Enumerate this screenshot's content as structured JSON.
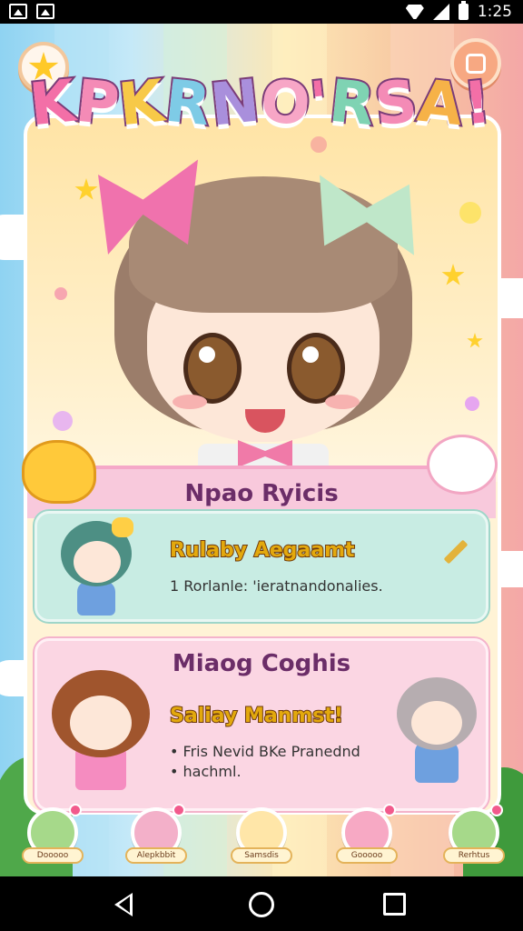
{
  "status_bar": {
    "time": "1:25"
  },
  "header": {
    "logo_letters": [
      {
        "ch": "K",
        "color": "#f36fa7"
      },
      {
        "ch": "P",
        "color": "#f48bb6"
      },
      {
        "ch": "K",
        "color": "#f7c948"
      },
      {
        "ch": "R",
        "color": "#7ecbe6"
      },
      {
        "ch": "N",
        "color": "#a98fdc"
      },
      {
        "ch": "O",
        "color": "#f7a6c6"
      },
      {
        "ch": "'",
        "color": "#f36fa7"
      },
      {
        "ch": "R",
        "color": "#7fd3b3"
      },
      {
        "ch": "S",
        "color": "#f48bb6"
      },
      {
        "ch": "A",
        "color": "#f6b248"
      },
      {
        "ch": "!",
        "color": "#f36fa7"
      }
    ]
  },
  "panel": {
    "title": "Npao Ryicis",
    "card1": {
      "heading": "Rulaby Aegaamt",
      "text": "1 Rorlanle: 'ieratnandonalies."
    },
    "card2": {
      "title": "Miaog Coghis",
      "heading": "Saliay Manmst!",
      "lines": [
        "• Fris Nevid BKe Pranednd",
        "• hachml."
      ]
    }
  },
  "bottom_nav": [
    {
      "label": "Dooooo",
      "color": "#a6d98a"
    },
    {
      "label": "Alepkbbit",
      "color": "#f3b0c9"
    },
    {
      "label": "Samsdis",
      "color": "#ffe6a8"
    },
    {
      "label": "Gooooo",
      "color": "#f7a9c4"
    },
    {
      "label": "Rerhtus",
      "color": "#a6d98a"
    }
  ],
  "colors": {
    "panel_title": "#6b2d68",
    "heading_gold": "#e3a90d",
    "accent_pink": "#f36fa7"
  }
}
